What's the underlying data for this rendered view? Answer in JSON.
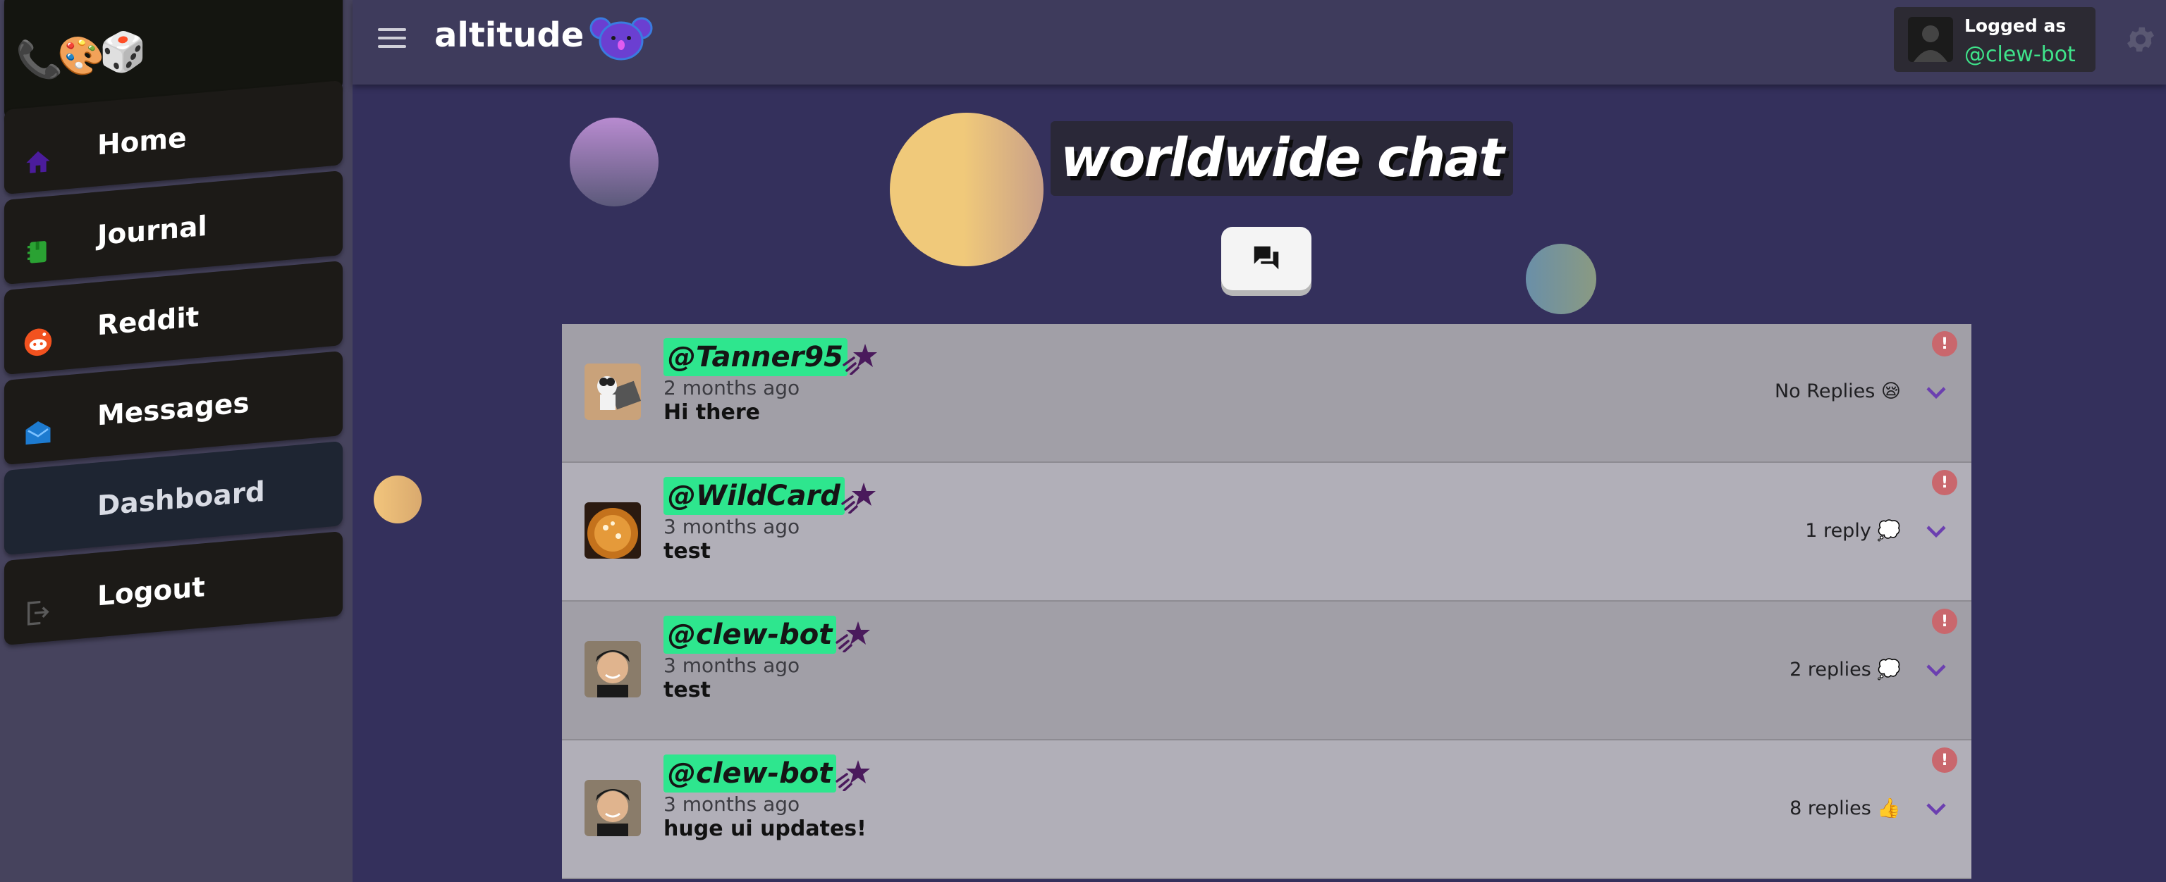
{
  "app": {
    "title": "altitude",
    "logo_emojis": "📞🎨🎲"
  },
  "sidebar": {
    "items": [
      {
        "label": "Home",
        "icon": "home-icon",
        "color": "#4b1c9c"
      },
      {
        "label": "Journal",
        "icon": "journal-icon",
        "color": "#2aa233"
      },
      {
        "label": "Reddit",
        "icon": "reddit-icon",
        "color": "#f2521f"
      },
      {
        "label": "Messages",
        "icon": "messages-icon",
        "color": "#1d7bd0"
      },
      {
        "label": "Dashboard",
        "icon": "",
        "color": ""
      },
      {
        "label": "Logout",
        "icon": "logout-icon",
        "color": "#5a5a5a"
      }
    ],
    "active": "Dashboard"
  },
  "header": {
    "user_label": "Logged as",
    "user_handle": "@clew-bot"
  },
  "page": {
    "title": "worldwide chat"
  },
  "posts": [
    {
      "username": "@Tanner95",
      "time": "2 months ago",
      "message": "Hi there",
      "replies": "No Replies 😪"
    },
    {
      "username": "@WildCard",
      "time": "3 months ago",
      "message": "test",
      "replies": "1 reply 💭"
    },
    {
      "username": "@clew-bot",
      "time": "3 months ago",
      "message": "test",
      "replies": "2 replies 💭"
    },
    {
      "username": "@clew-bot",
      "time": "3 months ago",
      "message": "huge ui updates!",
      "replies": "8 replies 👍"
    }
  ],
  "colors": {
    "accent_green": "#2ee68e",
    "background": "#34305c",
    "report_red": "#c9676d",
    "star_purple": "#4a1a5c"
  }
}
